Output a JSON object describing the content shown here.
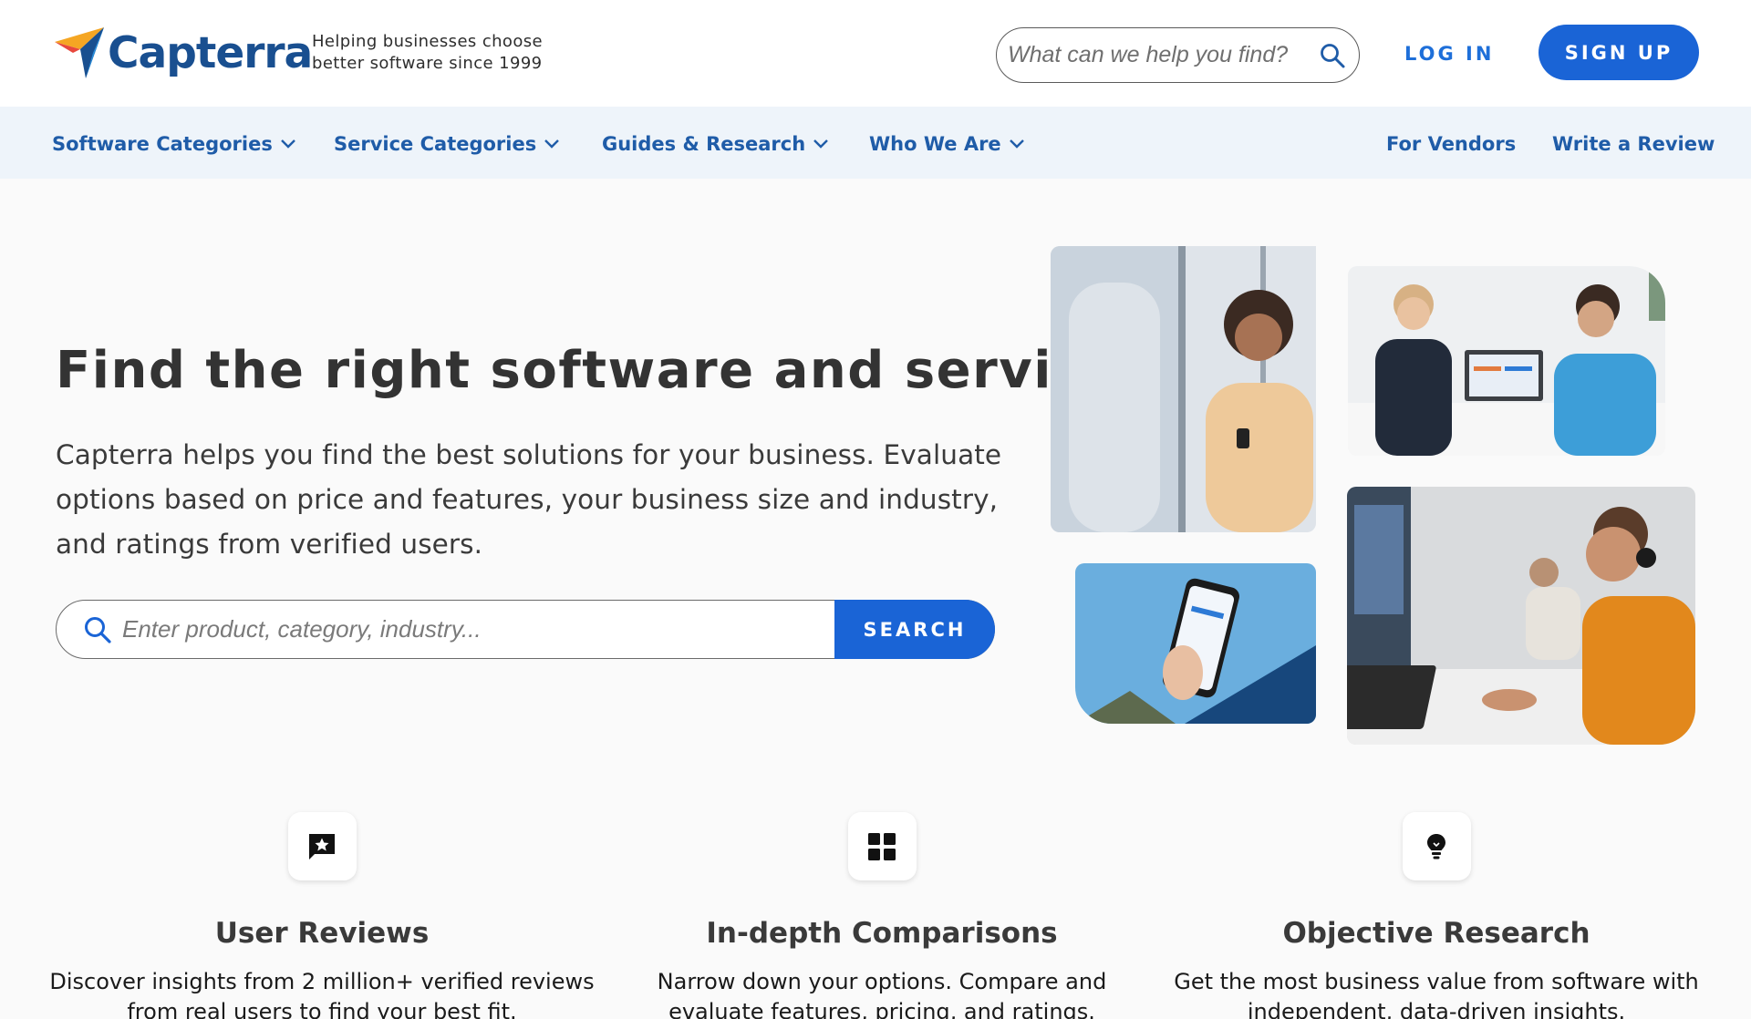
{
  "brand": {
    "name": "Capterra",
    "tagline_line1": "Helping businesses choose",
    "tagline_line2": "better software since 1999"
  },
  "header": {
    "search_placeholder": "What can we help you find?",
    "login_label": "LOG IN",
    "signup_label": "SIGN UP"
  },
  "nav": {
    "items": [
      {
        "label": "Software Categories",
        "icon": "chevron-down-icon"
      },
      {
        "label": "Service Categories",
        "icon": "chevron-down-icon"
      },
      {
        "label": "Guides & Research",
        "icon": "chevron-down-icon"
      },
      {
        "label": "Who We Are",
        "icon": "chevron-down-icon"
      }
    ],
    "for_vendors": "For Vendors",
    "write_review": "Write a Review"
  },
  "hero": {
    "title": "Find the right software and services",
    "description": "Capterra helps you find the best solutions for your business. Evaluate options based on price and features, your business size and industry, and ratings from verified users.",
    "search_placeholder": "Enter product, category, industry...",
    "search_button": "SEARCH"
  },
  "features": [
    {
      "icon": "review-star-icon",
      "title": "User Reviews",
      "description": "Discover insights from 2 million+ verified reviews from real users to find your best fit."
    },
    {
      "icon": "grid-icon",
      "title": "In-depth Comparisons",
      "description": "Narrow down your options. Compare and evaluate features, pricing, and ratings."
    },
    {
      "icon": "lightbulb-icon",
      "title": "Objective Research",
      "description": "Get the most business value from software with independent, data-driven insights."
    }
  ],
  "colors": {
    "brand_blue": "#194f90",
    "accent_blue": "#1a64d6",
    "nav_background": "#eef4fa",
    "logo_orange": "#f5a623",
    "logo_red": "#e8483d",
    "logo_blue": "#2a8cd8"
  }
}
